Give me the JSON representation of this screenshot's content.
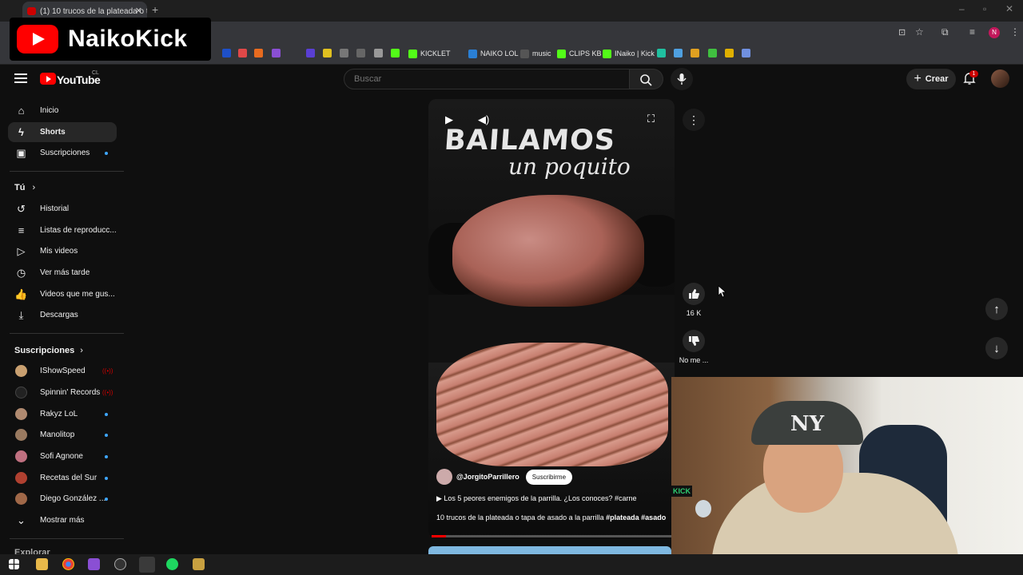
{
  "browser": {
    "tab_title": "(1) 10 trucos de la plateada o ta...",
    "new_tab": "+",
    "bookmarks": [
      "KICKLET",
      "NAIKO LOL",
      "music",
      "CLIPS KB",
      "INaiko | Kick"
    ]
  },
  "overlay": {
    "channel_name": "NaikoKick"
  },
  "header": {
    "logo_text": "YouTube",
    "country_code": "CL",
    "search_placeholder": "Buscar",
    "create_label": "Crear",
    "notification_count": "1"
  },
  "sidebar": {
    "main": [
      {
        "label": "Inicio",
        "icon": "home-icon"
      },
      {
        "label": "Shorts",
        "icon": "shorts-icon",
        "active": true
      },
      {
        "label": "Suscripciones",
        "icon": "subscriptions-icon"
      }
    ],
    "you_title": "Tú",
    "you": [
      {
        "label": "Historial",
        "icon": "history-icon"
      },
      {
        "label": "Listas de reproducc...",
        "icon": "playlist-icon"
      },
      {
        "label": "Mis videos",
        "icon": "my-videos-icon"
      },
      {
        "label": "Ver más tarde",
        "icon": "clock-icon"
      },
      {
        "label": "Videos que me gus...",
        "icon": "like-icon"
      },
      {
        "label": "Descargas",
        "icon": "download-icon"
      }
    ],
    "subs_title": "Suscripciones",
    "subs": [
      {
        "label": "IShowSpeed",
        "color": "#c9a070",
        "status": "live"
      },
      {
        "label": "Spinnin' Records",
        "color": "#222222",
        "status": "live"
      },
      {
        "label": "Rakyz LoL",
        "color": "#b08a70",
        "status": "new"
      },
      {
        "label": "Manolitop",
        "color": "#9a7a60",
        "status": "new"
      },
      {
        "label": "Sofi Agnone",
        "color": "#c07080",
        "status": "new"
      },
      {
        "label": "Recetas del Sur",
        "color": "#b04030",
        "status": "new"
      },
      {
        "label": "Diego González ...",
        "color": "#a06848",
        "status": "new"
      }
    ],
    "show_more": "Mostrar más",
    "explore": "Explorar"
  },
  "short": {
    "shirt_line1": "BAILAMOS",
    "shirt_line2": "un poquito",
    "channel": "@JorgitoParrillero",
    "subscribe": "Suscribirme",
    "related": "Los 5 peores enemigos de la parrilla. ¿Los conoces? #carne",
    "title_plain": "10 trucos de la plateada o tapa de asado a la parrilla ",
    "title_tags": "#plateada #asado",
    "progress": 0.06
  },
  "actions": {
    "like_count": "16 K",
    "dislike_label": "No me ..."
  },
  "webcam": {
    "card_text": "KICK"
  },
  "colors": {
    "accent": "#ff0000",
    "blue_dot": "#3ea6ff",
    "bg": "#0f0f0f"
  }
}
